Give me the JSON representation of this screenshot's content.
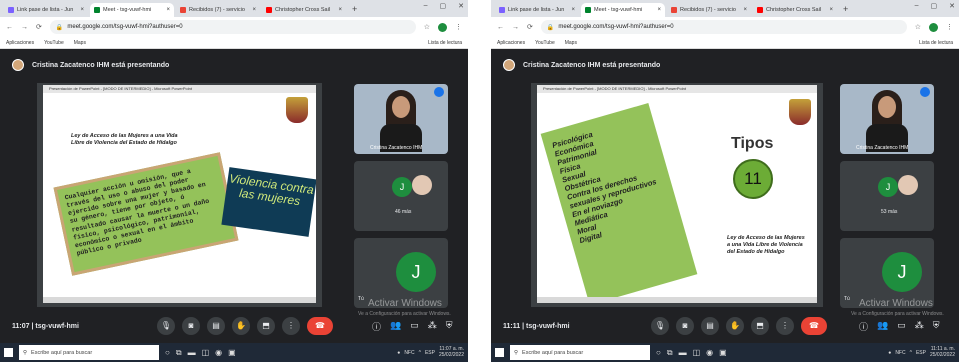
{
  "screens": [
    {
      "tabs": [
        "Link pase de lista - Jun",
        "Meet - tsg-vuwf-hmi",
        "Recibidos (7) - servicio",
        "Christopher Cross Sail"
      ],
      "url": "meet.google.com/tsg-vuwf-hmi?authuser=0",
      "bookmarks": [
        "Aplicaciones",
        "YouTube",
        "Maps"
      ],
      "reading_list": "Lista de lectura",
      "presenter_text": "Cristina Zacatenco IHM está presentando",
      "ppt_title": "Presentación de PowerPoint - [MODO DE INTERMEDIO] - Microsoft PowerPoint",
      "law_text": "Ley de Acceso de las Mujeres a una Vida Libre de Violencia del Estado de Hidalgo",
      "definition_text": "Cualquier acción u omisión, que a través del uso o abuso del poder ejercido sobre una mujer y basado en su género, tiene por objeto, ó resultado causar la muerte o un daño físico, psicológico, patrimonial, económico o sexual en el ámbito público o privado",
      "violencia_text": "Violencia contra las mujeres",
      "camera_name": "Cristina Zacatenco IHM",
      "avatar_letter": "J",
      "more_count": "46 más",
      "big_letter": "J",
      "tu_label": "Tú",
      "activate_title": "Activar Windows",
      "activate_sub": "Ve a Configuración para activar Windows.",
      "meeting_time": "11:07",
      "meeting_code": "tsg-vuwf-hmi",
      "taskbar_search": "Escribe aquí para buscar",
      "tray_label": "NFC",
      "lang": "ESP",
      "clock_time": "11:07 a. m.",
      "clock_date": "25/02/2022"
    },
    {
      "tabs": [
        "Link pase de lista - Jun",
        "Meet - tsg-vuwf-hmi",
        "Recibidos (7) - servicio",
        "Christopher Cross Sail"
      ],
      "url": "meet.google.com/tsg-vuwf-hmi?authuser=0",
      "bookmarks": [
        "Aplicaciones",
        "YouTube",
        "Maps"
      ],
      "reading_list": "Lista de lectura",
      "presenter_text": "Cristina Zacatenco IHM está presentando",
      "ppt_title": "Presentación de PowerPoint - [MODO DE INTERMEDIO] - Microsoft PowerPoint",
      "types_list": [
        "Psicológica",
        "Económica",
        "Patrimonial",
        "Física",
        "Sexual",
        "Obstétrica",
        "Contra los derechos sexuales y reproductivos",
        "En el noviazgo",
        "Mediática",
        "Moral",
        "Digital"
      ],
      "tipos_title": "Tipos",
      "tipos_count": "11",
      "law_text": "Ley de Acceso de las Mujeres a una Vida Libre de Violencia del Estado de Hidalgo",
      "camera_name": "Cristina Zacatenco IHM",
      "avatar_letter": "J",
      "more_count": "53 más",
      "big_letter": "J",
      "tu_label": "Tú",
      "activate_title": "Activar Windows",
      "activate_sub": "Ve a Configuración para activar Windows.",
      "meeting_time": "11:11",
      "meeting_code": "tsg-vuwf-hmi",
      "taskbar_search": "Escribe aquí para buscar",
      "tray_label": "NFC",
      "lang": "ESP",
      "clock_time": "11:11 a. m.",
      "clock_date": "25/02/2022"
    }
  ],
  "colors": {
    "meet_bg": "#202124",
    "end_call": "#ea4335",
    "avatar_green": "#1e8e3e",
    "slide_green": "#94c25a",
    "violencia_bg": "#0f3b55"
  },
  "icons": [
    "mic-icon",
    "camera-icon",
    "captions-icon",
    "raise-hand-icon",
    "present-icon",
    "more-icon",
    "end-call-icon",
    "info-icon",
    "people-icon",
    "chat-icon",
    "activities-icon",
    "lock-icon"
  ]
}
